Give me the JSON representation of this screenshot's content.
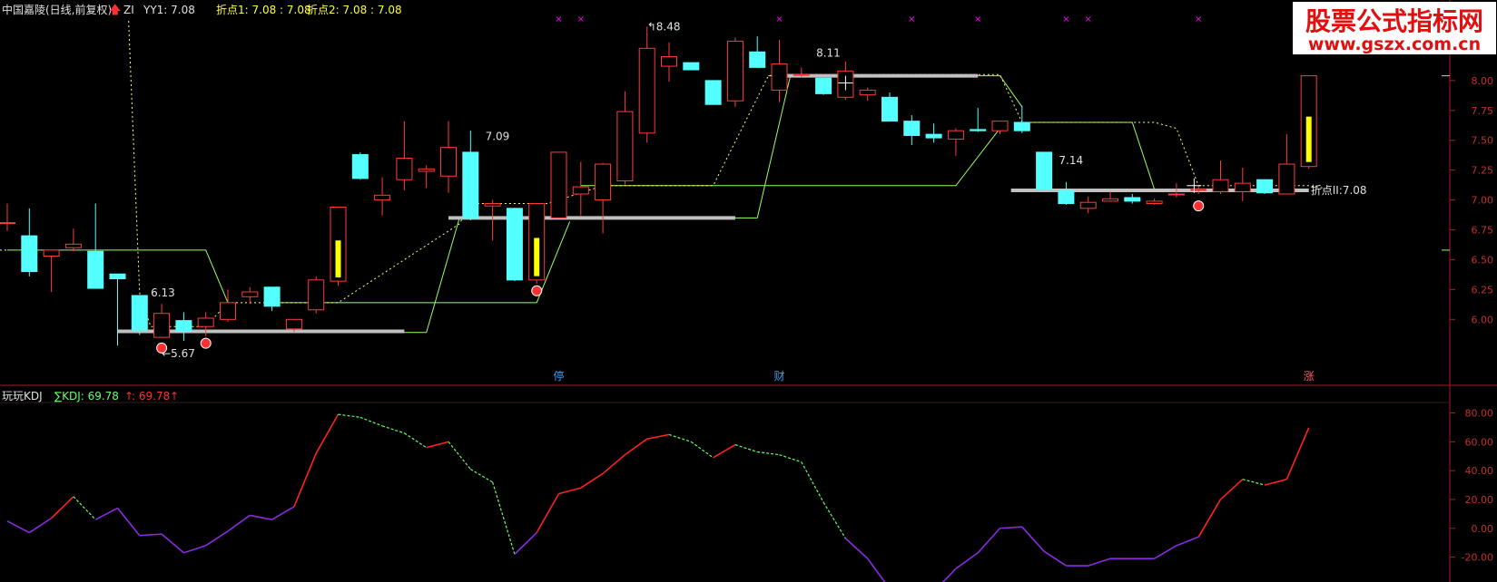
{
  "header": {
    "main": {
      "stock": "中国嘉陵(日线,前复权)",
      "flag": "ZI",
      "yy1_label": "YY1: 7.08",
      "pivot1": "折点1: 7.08 : 7.08",
      "pivot2": "折点2: 7.08 : 7.08"
    },
    "indicator": {
      "name": "玩玩KDJ",
      "kdj_label": "∑KDJ: 69.78",
      "kdj_value2": ": 69.78"
    }
  },
  "watermark": {
    "line1": "股票公式指标网",
    "line2": "www.gszx.com.cn"
  },
  "colors": {
    "up": "#ff3b3b",
    "down": "#54ffff",
    "limit_up": "#ffff00",
    "kdj_up": "#ff2020",
    "kdj_down": "#66ff66",
    "kdj_low": "#8a2be2",
    "support": "#c0c0c0",
    "trail_dot": "#ffff66",
    "level_line": "#99ff66",
    "marker": "#ff00ff"
  },
  "chart_data": [
    {
      "type": "candlestick",
      "title": "中国嘉陵(日线,前复权)",
      "ylim": [
        5.6,
        8.5
      ],
      "y_ticks": [
        6.0,
        6.25,
        6.5,
        6.75,
        7.0,
        7.25,
        7.5,
        7.75,
        8.0
      ],
      "y_tick_labels": [
        "6.00",
        "6.25",
        "6.50",
        "6.75",
        "7.00",
        "7.25",
        "7.50",
        "7.75",
        "8.00"
      ],
      "candles": [
        {
          "o": 6.81,
          "h": 6.97,
          "l": 6.74,
          "c": 6.81
        },
        {
          "o": 6.7,
          "h": 6.93,
          "l": 6.36,
          "c": 6.4
        },
        {
          "o": 6.53,
          "h": 6.55,
          "l": 6.23,
          "c": 6.58
        },
        {
          "o": 6.6,
          "h": 6.76,
          "l": 6.57,
          "c": 6.63
        },
        {
          "o": 6.57,
          "h": 6.97,
          "l": 6.26,
          "c": 6.26
        },
        {
          "o": 6.38,
          "h": 6.38,
          "l": 5.78,
          "c": 6.34
        },
        {
          "o": 6.2,
          "h": 6.2,
          "l": 5.87,
          "c": 5.91
        },
        {
          "o": 5.85,
          "h": 6.13,
          "l": 5.85,
          "c": 6.05
        },
        {
          "o": 5.99,
          "h": 6.06,
          "l": 5.82,
          "c": 5.9
        },
        {
          "o": 5.94,
          "h": 6.06,
          "l": 5.86,
          "c": 6.01
        },
        {
          "o": 6.0,
          "h": 6.25,
          "l": 5.98,
          "c": 6.14
        },
        {
          "o": 6.19,
          "h": 6.27,
          "l": 6.13,
          "c": 6.23
        },
        {
          "o": 6.27,
          "h": 6.27,
          "l": 6.07,
          "c": 6.11
        },
        {
          "o": 5.92,
          "h": 6.0,
          "l": 5.89,
          "c": 6.0
        },
        {
          "o": 6.08,
          "h": 6.36,
          "l": 6.05,
          "c": 6.33
        },
        {
          "o": 6.32,
          "h": 6.94,
          "l": 6.28,
          "c": 6.94,
          "limit": true
        },
        {
          "o": 7.38,
          "h": 7.4,
          "l": 7.17,
          "c": 7.18
        },
        {
          "o": 7.0,
          "h": 7.19,
          "l": 6.87,
          "c": 7.04
        },
        {
          "o": 7.17,
          "h": 7.66,
          "l": 7.08,
          "c": 7.35
        },
        {
          "o": 7.24,
          "h": 7.29,
          "l": 7.1,
          "c": 7.26
        },
        {
          "o": 7.2,
          "h": 7.66,
          "l": 7.06,
          "c": 7.44
        },
        {
          "o": 7.4,
          "h": 7.58,
          "l": 6.83,
          "c": 6.85
        },
        {
          "o": 6.95,
          "h": 7.0,
          "l": 6.66,
          "c": 6.97
        },
        {
          "o": 6.93,
          "h": 6.93,
          "l": 6.32,
          "c": 6.33
        },
        {
          "o": 6.33,
          "h": 6.97,
          "l": 6.3,
          "c": 6.97,
          "limit": true
        },
        {
          "o": 6.85,
          "h": 7.34,
          "l": 6.85,
          "c": 7.4
        },
        {
          "o": 7.05,
          "h": 7.32,
          "l": 6.87,
          "c": 7.11
        },
        {
          "o": 7.0,
          "h": 7.31,
          "l": 6.72,
          "c": 7.3
        },
        {
          "o": 7.16,
          "h": 7.91,
          "l": 7.13,
          "c": 7.74
        },
        {
          "o": 7.56,
          "h": 8.45,
          "l": 7.48,
          "c": 8.27
        },
        {
          "o": 8.12,
          "h": 8.32,
          "l": 7.99,
          "c": 8.2
        },
        {
          "o": 8.15,
          "h": 8.15,
          "l": 8.09,
          "c": 8.09
        },
        {
          "o": 8.0,
          "h": 8.0,
          "l": 7.8,
          "c": 7.8
        },
        {
          "o": 7.83,
          "h": 8.36,
          "l": 7.78,
          "c": 8.33
        },
        {
          "o": 8.24,
          "h": 8.37,
          "l": 8.12,
          "c": 8.11
        },
        {
          "o": 7.92,
          "h": 8.34,
          "l": 7.82,
          "c": 8.14
        },
        {
          "o": 8.05,
          "h": 8.11,
          "l": 8.03,
          "c": 8.05
        },
        {
          "o": 8.02,
          "h": 8.02,
          "l": 7.88,
          "c": 7.89
        },
        {
          "o": 7.86,
          "h": 8.16,
          "l": 7.84,
          "c": 8.08
        },
        {
          "o": 7.88,
          "h": 7.94,
          "l": 7.83,
          "c": 7.92
        },
        {
          "o": 7.86,
          "h": 7.9,
          "l": 7.67,
          "c": 7.66
        },
        {
          "o": 7.66,
          "h": 7.71,
          "l": 7.46,
          "c": 7.54
        },
        {
          "o": 7.55,
          "h": 7.64,
          "l": 7.48,
          "c": 7.52
        },
        {
          "o": 7.51,
          "h": 7.6,
          "l": 7.37,
          "c": 7.58
        },
        {
          "o": 7.59,
          "h": 7.77,
          "l": 7.57,
          "c": 7.58
        },
        {
          "o": 7.58,
          "h": 7.66,
          "l": 7.55,
          "c": 7.66
        },
        {
          "o": 7.65,
          "h": 7.79,
          "l": 7.56,
          "c": 7.58
        },
        {
          "o": 7.4,
          "h": 7.4,
          "l": 7.09,
          "c": 7.09
        },
        {
          "o": 7.08,
          "h": 7.15,
          "l": 6.96,
          "c": 6.97
        },
        {
          "o": 6.93,
          "h": 7.03,
          "l": 6.89,
          "c": 6.98
        },
        {
          "o": 6.99,
          "h": 7.07,
          "l": 6.99,
          "c": 7.01
        },
        {
          "o": 7.02,
          "h": 7.05,
          "l": 6.97,
          "c": 6.99
        },
        {
          "o": 6.97,
          "h": 7.01,
          "l": 6.96,
          "c": 6.99
        },
        {
          "o": 7.05,
          "h": 7.14,
          "l": 7.02,
          "c": 7.05
        },
        {
          "o": 7.08,
          "h": 7.12,
          "l": 7.05,
          "c": 7.09
        },
        {
          "o": 7.07,
          "h": 7.33,
          "l": 7.05,
          "c": 7.17
        },
        {
          "o": 7.07,
          "h": 7.27,
          "l": 6.99,
          "c": 7.14
        },
        {
          "o": 7.17,
          "h": 7.17,
          "l": 7.05,
          "c": 7.06
        },
        {
          "o": 7.05,
          "h": 7.55,
          "l": 7.05,
          "c": 7.3
        },
        {
          "o": 7.28,
          "h": 8.04,
          "l": 7.26,
          "c": 8.04,
          "limit": true
        }
      ],
      "annotations": {
        "high_low_labels": [
          "6.13",
          "5.67",
          "7.09",
          "8.48",
          "8.11",
          "7.14"
        ],
        "pivot_label": "折点II:7.08",
        "event_labels": [
          "停",
          "财",
          "涨"
        ]
      }
    },
    {
      "type": "line",
      "title": "玩玩KDJ",
      "ylim": [
        -36,
        86
      ],
      "y_ticks": [
        80,
        60,
        40,
        20,
        0,
        -20
      ],
      "y_tick_labels": [
        "80.00",
        "60.00",
        "40.00",
        "20.00",
        "0.00",
        "-20.00"
      ],
      "series": [
        {
          "name": "∑KDJ",
          "values": [
            5,
            -3,
            7,
            22,
            6,
            14,
            -5,
            -4,
            -17,
            -12,
            -2,
            9,
            6,
            15,
            52,
            79,
            77,
            71,
            66,
            56,
            60,
            41,
            32,
            -18,
            -3,
            24,
            28,
            38,
            51,
            62,
            65,
            60,
            49,
            58,
            53,
            51,
            46,
            18,
            -7,
            -21,
            -42,
            -44,
            -44,
            -28,
            -17,
            0,
            1,
            -16,
            -26,
            -26,
            -21,
            -21,
            -21,
            -12,
            -6,
            20,
            34,
            30,
            34,
            69.78
          ]
        }
      ]
    }
  ]
}
